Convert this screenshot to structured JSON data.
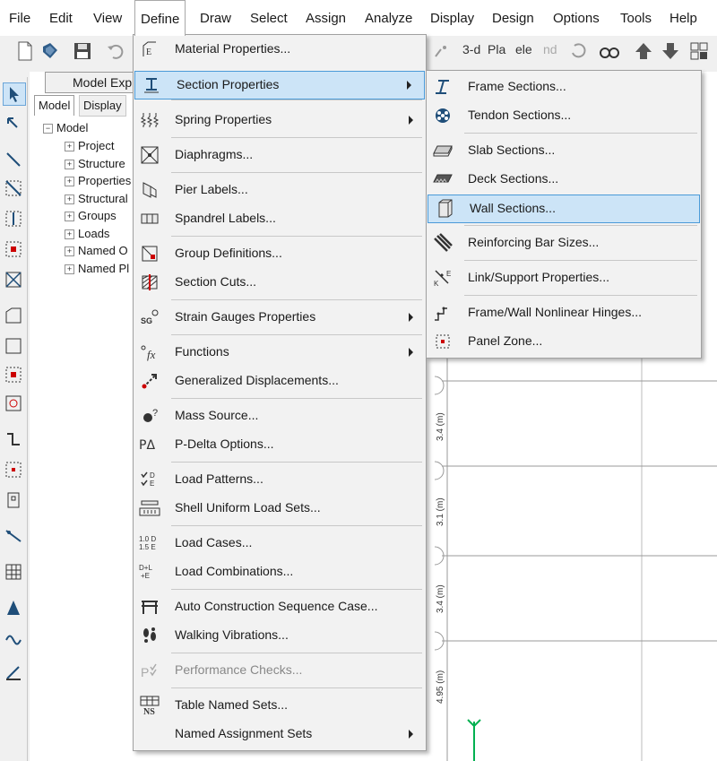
{
  "menubar": {
    "items": [
      "File",
      "Edit",
      "View",
      "Define",
      "Draw",
      "Select",
      "Assign",
      "Analyze",
      "Display",
      "Design",
      "Options",
      "Tools",
      "Help"
    ]
  },
  "toolbar": {
    "text_buttons": [
      "3-d",
      "Pla",
      "ele",
      "nd"
    ]
  },
  "explorer": {
    "title": "Model Exp",
    "tabs": [
      "Model",
      "Display"
    ],
    "root": "Model",
    "nodes": [
      "Project",
      "Structure",
      "Properties",
      "Structural",
      "Groups",
      "Loads",
      "Named O",
      "Named Pl"
    ]
  },
  "define_menu": {
    "items": [
      {
        "label": "Material Properties...",
        "icon": "material-icon"
      },
      {
        "label": "Section Properties",
        "icon": "section-icon",
        "submenu": true,
        "highlighted": true
      },
      {
        "label": "Spring Properties",
        "icon": "spring-icon",
        "submenu": true
      },
      {
        "label": "Diaphragms...",
        "icon": "diaphragm-icon"
      },
      {
        "label": "Pier Labels...",
        "icon": "pier-icon"
      },
      {
        "label": "Spandrel Labels...",
        "icon": "spandrel-icon"
      },
      {
        "label": "Group Definitions...",
        "icon": "group-icon"
      },
      {
        "label": "Section Cuts...",
        "icon": "section-cut-icon"
      },
      {
        "label": "Strain Gauges Properties",
        "icon": "strain-gauge-icon",
        "submenu": true
      },
      {
        "label": "Functions",
        "icon": "function-icon",
        "submenu": true
      },
      {
        "label": "Generalized Displacements...",
        "icon": "displacement-icon"
      },
      {
        "label": "Mass Source...",
        "icon": "mass-icon"
      },
      {
        "label": "P-Delta Options...",
        "icon": "pdelta-icon"
      },
      {
        "label": "Load Patterns...",
        "icon": "load-pattern-icon"
      },
      {
        "label": "Shell Uniform Load Sets...",
        "icon": "shell-load-icon"
      },
      {
        "label": "Load Cases...",
        "icon": "load-case-icon"
      },
      {
        "label": "Load Combinations...",
        "icon": "load-combo-icon"
      },
      {
        "label": "Auto Construction Sequence Case...",
        "icon": "construction-icon"
      },
      {
        "label": "Walking Vibrations...",
        "icon": "footsteps-icon"
      },
      {
        "label": "Performance Checks...",
        "icon": "performance-icon",
        "disabled": true
      },
      {
        "label": "Table Named Sets...",
        "icon": "table-icon"
      },
      {
        "label": "Named Assignment Sets",
        "icon": "assignment-icon",
        "submenu": true
      }
    ],
    "icon_text": {
      "pdelta": "PΔ",
      "strain": "SG",
      "fx": "fx",
      "ns": "NS",
      "d": "D",
      "e": "E",
      "lc1": "1.0 D",
      "lc2": "1.5 E",
      "dl": "D+L",
      "pe": "+E",
      "mq": "?"
    }
  },
  "section_submenu": {
    "items": [
      {
        "label": "Frame Sections...",
        "icon": "frame-section-icon"
      },
      {
        "label": "Tendon Sections...",
        "icon": "tendon-icon"
      },
      {
        "label": "Slab Sections...",
        "icon": "slab-icon"
      },
      {
        "label": "Deck Sections...",
        "icon": "deck-icon"
      },
      {
        "label": "Wall Sections...",
        "icon": "wall-icon",
        "highlighted": true
      },
      {
        "label": "Reinforcing Bar Sizes...",
        "icon": "rebar-icon"
      },
      {
        "label": "Link/Support Properties...",
        "icon": "link-icon"
      },
      {
        "label": "Frame/Wall Nonlinear Hinges...",
        "icon": "hinge-icon"
      },
      {
        "label": "Panel Zone...",
        "icon": "panel-zone-icon"
      }
    ]
  },
  "canvas": {
    "grid_labels": [
      "3.4 (m)",
      "3.1 (m)",
      "3.4 (m)",
      "4.95 (m)"
    ]
  },
  "colors": {
    "highlight": "#cce4f7",
    "highlight_border": "#4a9ad8",
    "menu_bg": "#f2f2f2"
  }
}
